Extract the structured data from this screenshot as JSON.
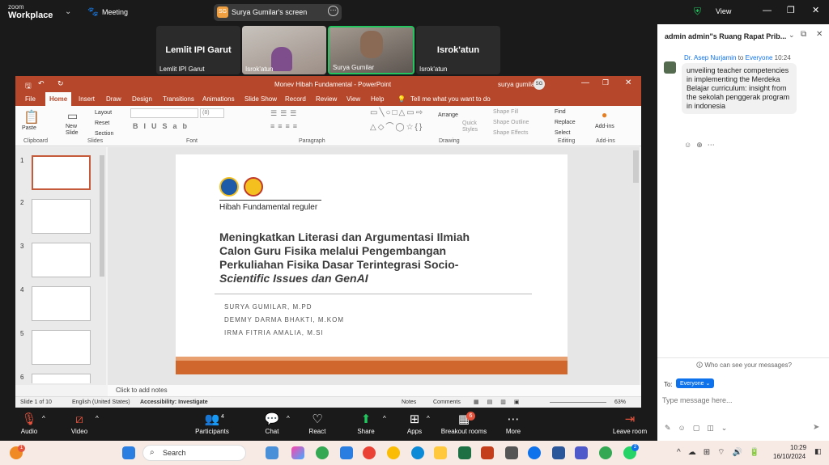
{
  "zoom": {
    "brand_small": "zoom",
    "brand": "Workplace",
    "meeting_label": "Meeting",
    "share_label": "Surya Gumilar's screen",
    "share_initials": "SG",
    "view_label": "View"
  },
  "tiles": [
    {
      "big": "Lemlit IPI Garut",
      "caption": "Lemlit IPI Garut"
    },
    {
      "big": "",
      "caption": "Isrok'atun"
    },
    {
      "big": "",
      "caption": "Surya Gumilar"
    },
    {
      "big": "Isrok'atun",
      "caption": "Isrok'atun"
    }
  ],
  "ppt": {
    "doc_title": "Monev Hibah Fundamental  -  PowerPoint",
    "user": "surya gumilar",
    "user_initials": "SG",
    "tabs": [
      "File",
      "Home",
      "Insert",
      "Draw",
      "Design",
      "Transitions",
      "Animations",
      "Slide Show",
      "Record",
      "Review",
      "View",
      "Help"
    ],
    "tell_me": "Tell me what you want to do",
    "ribbon": {
      "paste": "Paste",
      "new_slide": "New Slide",
      "layout": "Layout",
      "reset": "Reset",
      "section": "Section",
      "font_size": "(8)",
      "arrange": "Arrange",
      "quick_styles": "Quick Styles",
      "shape_fill": "Shape Fill",
      "shape_outline": "Shape Outline",
      "shape_effects": "Shape Effects",
      "find": "Find",
      "replace": "Replace",
      "select": "Select",
      "addins": "Add-ins",
      "groups": [
        "Clipboard",
        "Slides",
        "Font",
        "Paragraph",
        "Drawing",
        "Editing",
        "Add-ins"
      ]
    },
    "thumb_numbers": [
      "1",
      "2",
      "3",
      "4",
      "5",
      "6"
    ],
    "slide": {
      "subtitle": "Hibah Fundamental reguler",
      "title_lines": [
        "Meningkatkan Literasi dan Argumentasi Ilmiah",
        "Calon Guru Fisika melalui Pengembangan",
        "Perkuliahan Fisika Dasar Terintegrasi Socio-",
        "Scientific Issues dan GenAI"
      ],
      "authors": [
        "SURYA GUMILAR, M.PD",
        "DEMMY DARMA BHAKTI, M.KOM",
        "IRMA FITRIA AMALIA, M.SI"
      ]
    },
    "notes": "Click to add notes",
    "status": {
      "slide": "Slide 1 of 10",
      "lang": "English (United States)",
      "access": "Accessibility: Investigate",
      "notes": "Notes",
      "comments": "Comments",
      "zoom": "63%"
    }
  },
  "chat": {
    "title": "admin admin\"s Ruang Rapat Prib...",
    "sender": "Dr. Asep Nurjamin",
    "to_word": "to",
    "recipient": "Everyone",
    "time": "10:24",
    "message": "unveiling teacher competencies in implementing the Merdeka Belajar curriculum: insight from the sekolah penggerak program in indonesia",
    "who_can_see": "Who can see your messages?",
    "to_label": "To:",
    "to_value": "Everyone",
    "placeholder": "Type message here..."
  },
  "toolbar": {
    "audio": "Audio",
    "video": "Video",
    "participants": "Participants",
    "participants_count": "4",
    "chat": "Chat",
    "react": "React",
    "share": "Share",
    "apps": "Apps",
    "breakout": "Breakout rooms",
    "breakout_badge": "6",
    "more": "More",
    "leave": "Leave room"
  },
  "taskbar": {
    "search": "Search",
    "time": "10:29",
    "date": "16/10/2024",
    "notif_badge": "1",
    "whatsapp_badge": "2"
  },
  "colors": {
    "ppt_accent": "#b7472a",
    "zoom_green": "#22c55e",
    "zoom_blue": "#0e72ed"
  }
}
